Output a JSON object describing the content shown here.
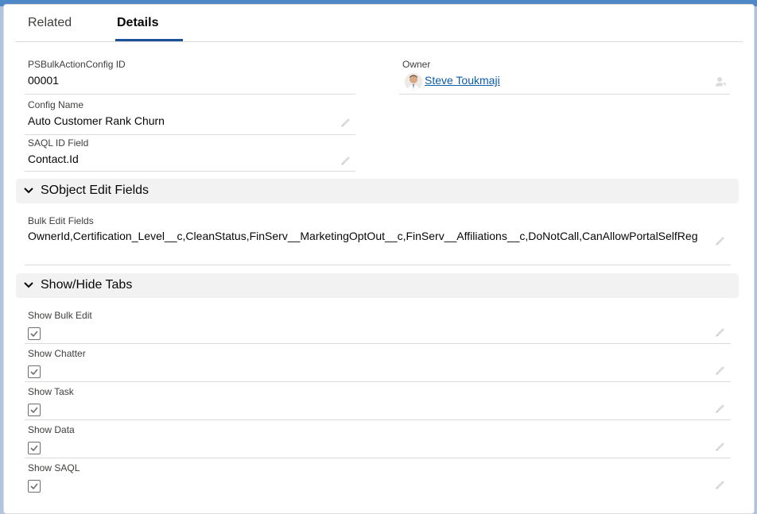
{
  "tabs": {
    "related_label": "Related",
    "details_label": "Details"
  },
  "fields": {
    "config_id": {
      "label": "PSBulkActionConfig ID",
      "value": "00001"
    },
    "owner": {
      "label": "Owner",
      "value": "Steve Toukmaji"
    },
    "config_name": {
      "label": "Config Name",
      "value": "Auto Customer Rank Churn"
    },
    "saql_id_field": {
      "label": "SAQL ID Field",
      "value": "Contact.Id"
    }
  },
  "sections": {
    "sobject": {
      "title": "SObject Edit Fields",
      "bulk_edit_fields": {
        "label": "Bulk Edit Fields",
        "value": "OwnerId,Certification_Level__c,CleanStatus,FinServ__MarketingOptOut__c,FinServ__Affiliations__c,DoNotCall,CanAllowPortalSelfReg"
      }
    },
    "show_hide": {
      "title": "Show/Hide Tabs",
      "checkboxes": [
        {
          "label": "Show Bulk Edit",
          "checked": true
        },
        {
          "label": "Show Chatter",
          "checked": true
        },
        {
          "label": "Show Task",
          "checked": true
        },
        {
          "label": "Show Data",
          "checked": true
        },
        {
          "label": "Show SAQL",
          "checked": true
        }
      ]
    }
  },
  "colors": {
    "accent": "#1b5297",
    "link": "#0b5cab",
    "section_bg": "#f3f2f2",
    "page_bg": "#b0c4df"
  }
}
